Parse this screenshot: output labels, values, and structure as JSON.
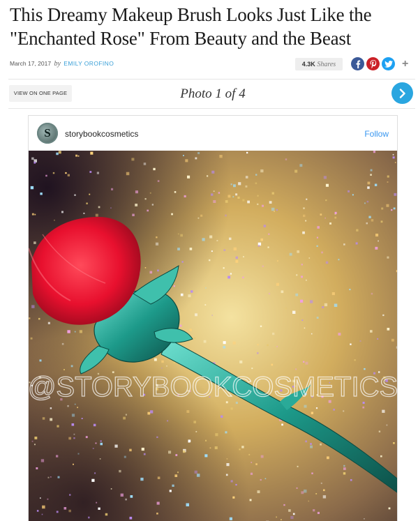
{
  "article": {
    "headline_line1": "This Dreamy Makeup Brush Looks Just Like the",
    "headline_line2": "\"Enchanted Rose\" From Beauty and the Beast",
    "date": "March 17, 2017",
    "by": "by",
    "author": "EMILY OROFINO"
  },
  "share": {
    "count": "4.3K",
    "label": "Shares",
    "more": "+"
  },
  "gallery": {
    "view_all_label": "VIEW ON ONE PAGE",
    "counter": "Photo 1 of 4"
  },
  "instagram": {
    "username": "storybookcosmetics",
    "follow_label": "Follow",
    "avatar_letter": "S",
    "photo_watermark": "@STORYBOOKCOSMETICS"
  },
  "colors": {
    "author": "#3aa0d8",
    "next_button": "#2aa6e0",
    "facebook": "#3b5998",
    "pinterest": "#cb2027",
    "twitter": "#1da1f2",
    "follow": "#3897f0"
  },
  "icons": [
    "facebook-icon",
    "pinterest-icon",
    "twitter-icon",
    "chevron-right-icon"
  ]
}
